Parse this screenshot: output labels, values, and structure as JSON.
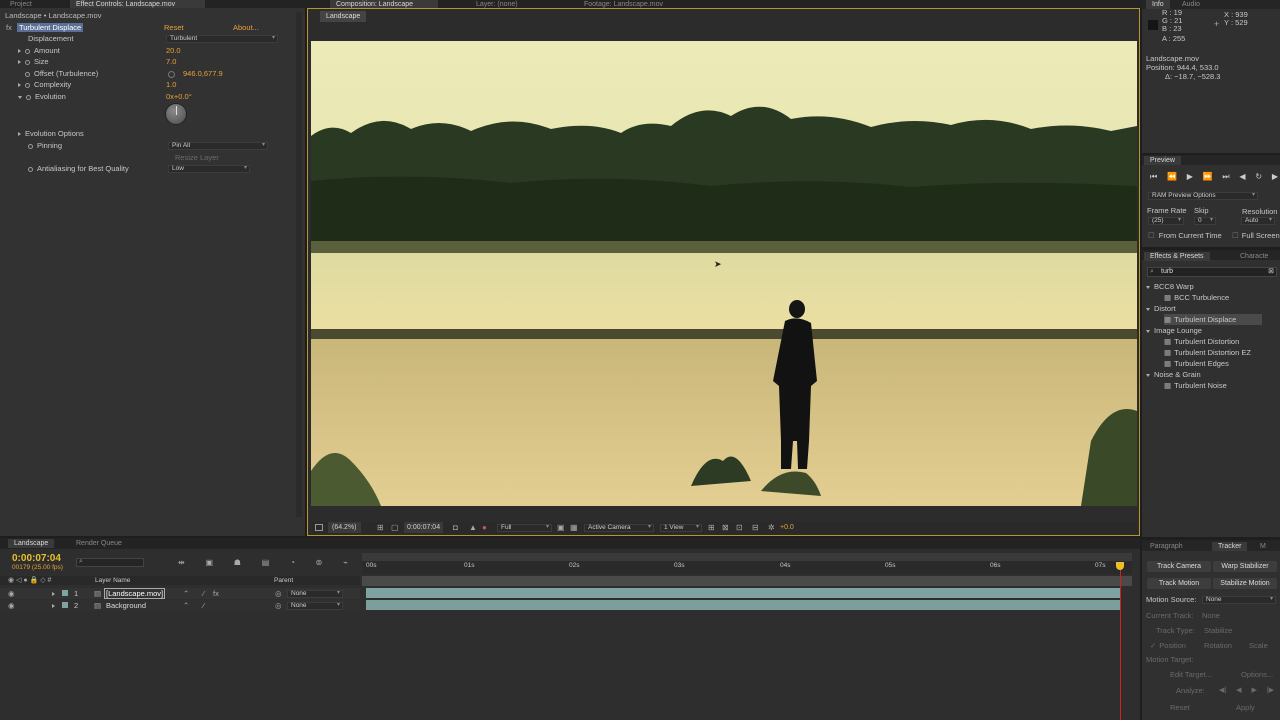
{
  "colors": {
    "accent": "#e8a13a",
    "panel": "#333333",
    "timecode": "#e8c12a",
    "track": "#7fa3a0",
    "playhead": "#d22020"
  },
  "top_tabs": {
    "project": "Project",
    "effect_controls": "Effect Controls: Landscape.mov",
    "composition": "Composition: Landscape",
    "layer": "Layer: (none)",
    "footage": "Footage: Landscape.mov"
  },
  "effect_controls": {
    "breadcrumb": "Landscape • Landscape.mov",
    "effect_name": "Turbulent Displace",
    "reset": "Reset",
    "about": "About...",
    "props": [
      {
        "label": "Displacement",
        "value": "Turbulent"
      },
      {
        "label": "Amount",
        "value": "20.0"
      },
      {
        "label": "Size",
        "value": "7.0"
      },
      {
        "label": "Offset (Turbulence)",
        "value": "946.0,677.9"
      },
      {
        "label": "Complexity",
        "value": "1.0"
      },
      {
        "label": "Evolution",
        "value": "0x+0.0°"
      },
      {
        "label": "Evolution Options",
        "value": ""
      },
      {
        "label": "Pinning",
        "value": "Pin All"
      },
      {
        "label": "",
        "value": "Resize Layer"
      },
      {
        "label": "Antialiasing for Best Quality",
        "value": "Low"
      }
    ]
  },
  "comp": {
    "tab": "Landscape",
    "zoom": "(64.2%)",
    "timecode": "0:00:07:04",
    "resolution": "Full",
    "camera": "Active Camera",
    "view": "1 View",
    "exposure": "+0.0"
  },
  "info": {
    "tab": "Info",
    "audio_tab": "Audio",
    "r": "R : 19",
    "g": "G : 21",
    "b": "B : 23",
    "a": "A : 255",
    "x": "X : 939",
    "y": "Y : 529",
    "file": "Landscape.mov",
    "position": "Position: 944.4, 533.0",
    "delta": "Δ: −18.7, −528.3"
  },
  "preview": {
    "tab": "Preview",
    "ram": "RAM Preview Options",
    "frame_rate_label": "Frame Rate",
    "skip_label": "Skip",
    "resolution_label": "Resolution",
    "frame_rate": "(25)",
    "skip": "0",
    "resolution": "Auto",
    "from_current": "From Current Time",
    "full_screen": "Full Screen"
  },
  "effects_presets": {
    "tab": "Effects & Presets",
    "charac_tab": "Characte",
    "search": "turb",
    "tree": [
      {
        "type": "group",
        "label": "BCC8 Warp"
      },
      {
        "type": "item",
        "label": "BCC Turbulence"
      },
      {
        "type": "group",
        "label": "Distort"
      },
      {
        "type": "item",
        "label": "Turbulent Displace",
        "selected": true
      },
      {
        "type": "group",
        "label": "Image Lounge"
      },
      {
        "type": "item",
        "label": "Turbulent Distortion"
      },
      {
        "type": "item",
        "label": "Turbulent Distortion EZ"
      },
      {
        "type": "item",
        "label": "Turbulent Edges"
      },
      {
        "type": "group",
        "label": "Noise & Grain"
      },
      {
        "type": "item",
        "label": "Turbulent Noise"
      }
    ]
  },
  "timeline": {
    "tab": "Landscape",
    "render_tab": "Render Queue",
    "timecode": "0:00:07:04",
    "frames": "00179 (25.00 fps)",
    "col_layer": "Layer Name",
    "col_parent": "Parent",
    "ruler": [
      "00s",
      "01s",
      "02s",
      "03s",
      "04s",
      "05s",
      "06s",
      "07s"
    ],
    "layers": [
      {
        "num": "1",
        "name": "[Landscape.mov]",
        "parent": "None"
      },
      {
        "num": "2",
        "name": "Background",
        "parent": "None"
      }
    ]
  },
  "tracker": {
    "paragraph_tab": "Paragraph",
    "tab": "Tracker",
    "m_tab": "M",
    "track_camera": "Track Camera",
    "warp_stabilizer": "Warp Stabilizer",
    "track_motion": "Track Motion",
    "stabilize_motion": "Stabilize Motion",
    "motion_source_label": "Motion Source:",
    "motion_source": "None",
    "current_track_label": "Current Track:",
    "current_track": "None",
    "track_type_label": "Track Type:",
    "track_type": "Stabilize",
    "position": "Position",
    "rotation": "Rotation",
    "scale": "Scale",
    "motion_target": "Motion Target:",
    "edit_target": "Edit Target...",
    "options": "Options...",
    "analyze": "Analyze:",
    "reset": "Reset",
    "apply": "Apply"
  }
}
